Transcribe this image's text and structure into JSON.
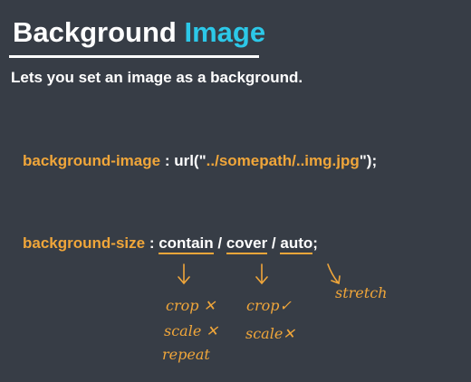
{
  "title": {
    "part1": "Background ",
    "part2": "Image"
  },
  "subtitle": "Lets you set an image as a background.",
  "line1": {
    "prop": "background-image",
    "sep": " : url(\"",
    "value": "../somepath/..img.jpg",
    "end": "\");"
  },
  "line2": {
    "prop": "background-size",
    "sep": " : ",
    "opt1": "contain",
    "slash1": " / ",
    "opt2": "cover",
    "slash2": " / ",
    "opt3": "auto",
    "end": ";"
  },
  "notes": {
    "contain_1": "crop ✕",
    "contain_2": "scale ✕",
    "contain_3": "repeat",
    "cover_1": "crop✓",
    "cover_2": "scale✕",
    "auto_1": "stretch"
  },
  "colors": {
    "background": "#373d46",
    "accent_cyan": "#2cc8e8",
    "accent_orange": "#f0a63a"
  }
}
